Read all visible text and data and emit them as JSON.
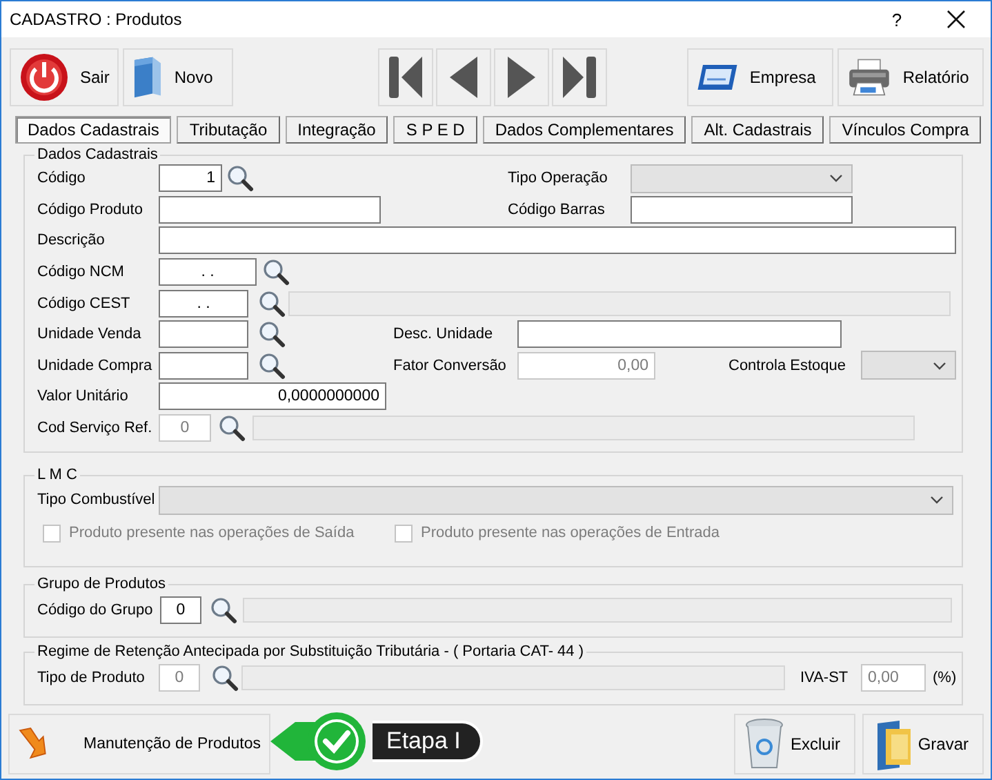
{
  "window": {
    "title": "CADASTRO : Produtos",
    "help": "?"
  },
  "toolbar_left": [
    {
      "label": "Sair"
    },
    {
      "label": "Novo"
    }
  ],
  "toolbar_right": [
    {
      "label": "Empresa"
    },
    {
      "label": "Relatório"
    }
  ],
  "tabs": [
    {
      "label": "Dados Cadastrais",
      "selected": true
    },
    {
      "label": "Tributação",
      "selected": false
    },
    {
      "label": "Integração",
      "selected": false
    },
    {
      "label": "S P E D",
      "selected": false
    },
    {
      "label": "Dados Complementares",
      "selected": false
    },
    {
      "label": "Alt. Cadastrais",
      "selected": false
    },
    {
      "label": "Vínculos Compra",
      "selected": false
    }
  ],
  "groups": [
    {
      "title": "Dados Cadastrais",
      "rows": [
        [
          {
            "label": "Código",
            "controls": [
              {
                "kind": "input",
                "value": "1",
                "disabled": false
              },
              {
                "kind": "search"
              }
            ]
          },
          {
            "label": "Tipo Operação",
            "controls": [
              {
                "kind": "select",
                "disabled": true
              }
            ]
          }
        ],
        [
          {
            "label": "Código Produto",
            "controls": [
              {
                "kind": "input",
                "disabled": false
              }
            ]
          },
          {
            "label": "Código Barras",
            "controls": [
              {
                "kind": "input",
                "disabled": false
              }
            ]
          }
        ],
        [
          {
            "label": "Descrição",
            "controls": [
              {
                "kind": "input",
                "disabled": false
              }
            ]
          }
        ],
        [
          {
            "label": "Código NCM",
            "controls": [
              {
                "kind": "input",
                "value": ". .",
                "disabled": false
              },
              {
                "kind": "search"
              }
            ]
          }
        ],
        [
          {
            "label": "Código CEST",
            "controls": [
              {
                "kind": "input",
                "value": ". .",
                "disabled": false
              },
              {
                "kind": "search"
              },
              {
                "kind": "display"
              }
            ]
          }
        ],
        [
          {
            "label": "Unidade Venda",
            "controls": [
              {
                "kind": "input",
                "disabled": false
              },
              {
                "kind": "search"
              }
            ]
          },
          {
            "label": "Desc. Unidade",
            "controls": [
              {
                "kind": "input",
                "disabled": false
              }
            ]
          }
        ],
        [
          {
            "label": "Unidade Compra",
            "controls": [
              {
                "kind": "input",
                "disabled": false
              },
              {
                "kind": "search"
              }
            ]
          },
          {
            "label": "Fator Conversão",
            "controls": [
              {
                "kind": "input",
                "value": "0,00",
                "disabled": true
              }
            ]
          },
          {
            "label": "Controla Estoque",
            "controls": [
              {
                "kind": "select",
                "disabled": true
              }
            ]
          }
        ],
        [
          {
            "label": "Valor Unitário",
            "controls": [
              {
                "kind": "input",
                "value": "0,0000000000",
                "disabled": false
              }
            ]
          }
        ],
        [
          {
            "label": "Cod Serviço Ref.",
            "controls": [
              {
                "kind": "input",
                "value": "0",
                "disabled": true
              },
              {
                "kind": "search"
              },
              {
                "kind": "display"
              }
            ]
          }
        ]
      ]
    },
    {
      "title": "L M C",
      "rows": [
        [
          {
            "label": "Tipo Combustível",
            "controls": [
              {
                "kind": "select",
                "disabled": true
              }
            ]
          }
        ],
        [
          {
            "controls": [
              {
                "kind": "checkbox",
                "text": "Produto presente nas operações de Saída",
                "checked": false,
                "disabled": true
              }
            ]
          },
          {
            "controls": [
              {
                "kind": "checkbox",
                "text": "Produto presente nas operações de Entrada",
                "checked": false,
                "disabled": true
              }
            ]
          }
        ]
      ]
    },
    {
      "title": "Grupo de Produtos",
      "rows": [
        [
          {
            "label": "Código do Grupo",
            "controls": [
              {
                "kind": "input",
                "value": "0",
                "disabled": false
              },
              {
                "kind": "search"
              },
              {
                "kind": "display"
              }
            ]
          }
        ]
      ]
    },
    {
      "title": "Regime de Retenção Antecipada por Substituição Tributária - ( Portaria CAT- 44 )",
      "rows": [
        [
          {
            "label": "Tipo de Produto",
            "controls": [
              {
                "kind": "input",
                "value": "0",
                "disabled": true
              },
              {
                "kind": "search"
              },
              {
                "kind": "display"
              }
            ]
          },
          {
            "label": "IVA-ST",
            "controls": [
              {
                "kind": "input",
                "value": "0,00",
                "disabled": true
              }
            ]
          },
          {
            "label": "(%)"
          }
        ]
      ]
    }
  ],
  "footer": {
    "maintenance": "Manutenção de Produtos",
    "step": "Etapa I",
    "buttons": [
      {
        "label": "Excluir"
      },
      {
        "label": "Gravar"
      }
    ]
  }
}
